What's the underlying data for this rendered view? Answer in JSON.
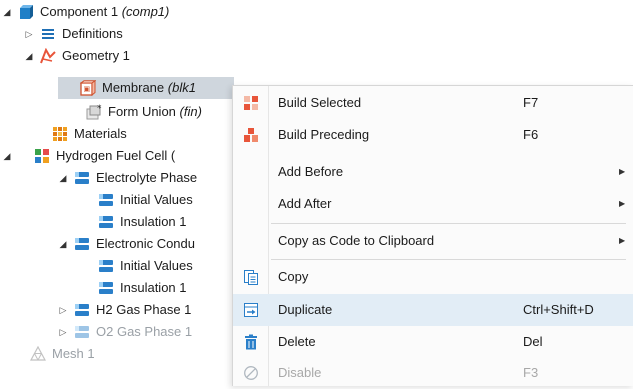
{
  "tree": {
    "component": {
      "name": "Component 1",
      "tag": "(comp1)"
    },
    "definitions": "Definitions",
    "geometry": "Geometry 1",
    "membrane": {
      "name": "Membrane",
      "tag": "(blk1"
    },
    "form_union": {
      "name": "Form Union",
      "tag": "(fin)"
    },
    "materials": "Materials",
    "hydrogen_fuel_cell": "Hydrogen Fuel Cell",
    "hydrogen_fuel_cell_tag": "(",
    "electrolyte_phase": "Electrolyte Phase",
    "initial_values_1": "Initial Values",
    "insulation_1a": "Insulation 1",
    "electronic_conduction": "Electronic Condu",
    "initial_values_2": "Initial Values",
    "insulation_1b": "Insulation 1",
    "h2_gas_phase": "H2 Gas Phase 1",
    "o2_gas_phase": "O2 Gas Phase 1",
    "mesh": "Mesh 1"
  },
  "menu": {
    "build_selected": {
      "label": "Build Selected",
      "shortcut": "F7"
    },
    "build_preceding": {
      "label": "Build Preceding",
      "shortcut": "F6"
    },
    "add_before": {
      "label": "Add Before"
    },
    "add_after": {
      "label": "Add After"
    },
    "copy_as_code": {
      "label": "Copy as Code to Clipboard"
    },
    "copy": {
      "label": "Copy"
    },
    "duplicate": {
      "label": "Duplicate",
      "shortcut": "Ctrl+Shift+D"
    },
    "delete": {
      "label": "Delete",
      "shortcut": "Del"
    },
    "disable": {
      "label": "Disable",
      "shortcut": "F3"
    }
  },
  "colors": {
    "accent_blue": "#2a7fc9",
    "selection_bg": "#cfd6dd",
    "menu_hover_bg": "#e2edf6",
    "geometry_red": "#e8553a",
    "materials_orange": "#f0a020"
  },
  "icons": {
    "component": "component-cube-icon",
    "definitions": "definitions-list-icon",
    "geometry": "geometry-icon",
    "block": "block-icon",
    "form_union": "form-union-icon",
    "materials": "materials-icon",
    "physics": "physics-interface-icon",
    "physics_node": "physics-node-icon",
    "mesh": "mesh-icon"
  }
}
